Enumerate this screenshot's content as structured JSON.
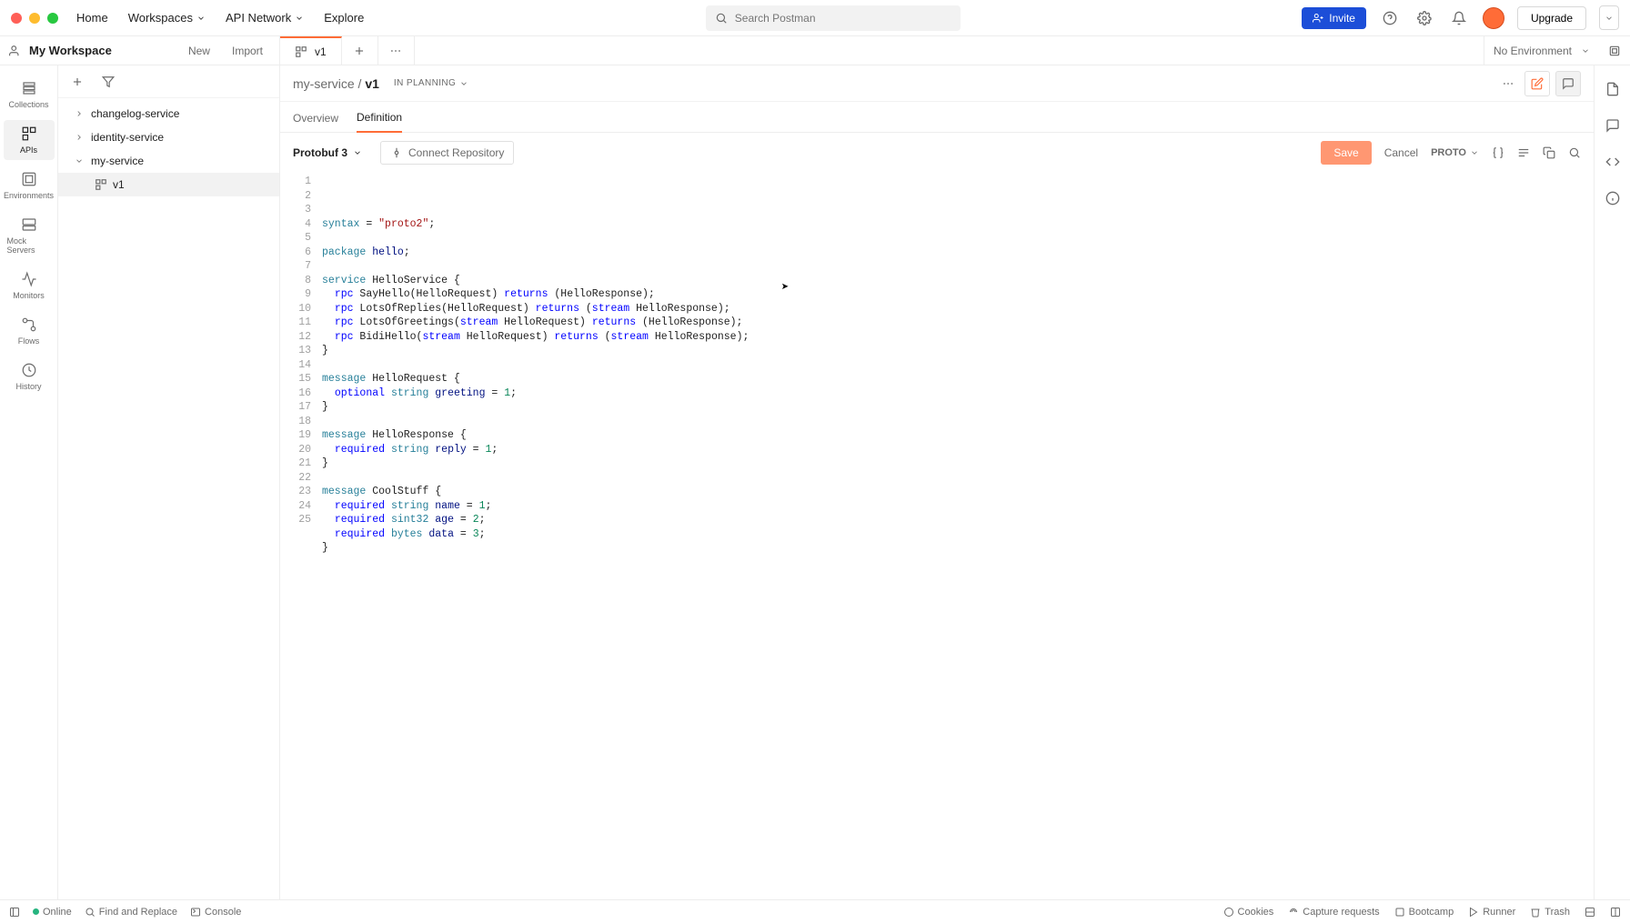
{
  "topnav": {
    "home": "Home",
    "workspaces": "Workspaces",
    "api_network": "API Network",
    "explore": "Explore"
  },
  "search": {
    "placeholder": "Search Postman"
  },
  "topright": {
    "invite": "Invite",
    "upgrade": "Upgrade"
  },
  "workspace": {
    "name": "My Workspace",
    "new": "New",
    "import": "Import"
  },
  "tabs": {
    "active": "v1"
  },
  "env": {
    "label": "No Environment"
  },
  "rail": {
    "collections": "Collections",
    "apis": "APIs",
    "environments": "Environments",
    "mock": "Mock Servers",
    "monitors": "Monitors",
    "flows": "Flows",
    "history": "History"
  },
  "tree": {
    "items": [
      {
        "label": "changelog-service"
      },
      {
        "label": "identity-service"
      },
      {
        "label": "my-service",
        "children": [
          {
            "label": "v1"
          }
        ]
      }
    ]
  },
  "breadcrumb": {
    "parent": "my-service",
    "current": "v1",
    "status": "IN PLANNING"
  },
  "subtabs": {
    "overview": "Overview",
    "definition": "Definition"
  },
  "editor_toolbar": {
    "schema": "Protobuf 3",
    "connect": "Connect Repository",
    "save": "Save",
    "cancel": "Cancel",
    "lang": "PROTO"
  },
  "code": {
    "lines": [
      [
        [
          "kw",
          "syntax"
        ],
        [
          "",
          " = "
        ],
        [
          "str",
          "\"proto2\""
        ],
        [
          "",
          ";"
        ]
      ],
      [],
      [
        [
          "kw",
          "package"
        ],
        [
          "",
          " "
        ],
        [
          "id",
          "hello"
        ],
        [
          "",
          ";"
        ]
      ],
      [],
      [
        [
          "kw",
          "service"
        ],
        [
          "",
          " HelloService {"
        ]
      ],
      [
        [
          "",
          "  "
        ],
        [
          "kw2",
          "rpc"
        ],
        [
          "",
          " SayHello(HelloRequest) "
        ],
        [
          "kw2",
          "returns"
        ],
        [
          "",
          " (HelloResponse);"
        ]
      ],
      [
        [
          "",
          "  "
        ],
        [
          "kw2",
          "rpc"
        ],
        [
          "",
          " LotsOfReplies(HelloRequest) "
        ],
        [
          "kw2",
          "returns"
        ],
        [
          "",
          " ("
        ],
        [
          "kw2",
          "stream"
        ],
        [
          "",
          " HelloResponse);"
        ]
      ],
      [
        [
          "",
          "  "
        ],
        [
          "kw2",
          "rpc"
        ],
        [
          "",
          " LotsOfGreetings("
        ],
        [
          "kw2",
          "stream"
        ],
        [
          "",
          " HelloRequest) "
        ],
        [
          "kw2",
          "returns"
        ],
        [
          "",
          " (HelloResponse);"
        ]
      ],
      [
        [
          "",
          "  "
        ],
        [
          "kw2",
          "rpc"
        ],
        [
          "",
          " BidiHello("
        ],
        [
          "kw2",
          "stream"
        ],
        [
          "",
          " HelloRequest) "
        ],
        [
          "kw2",
          "returns"
        ],
        [
          "",
          " ("
        ],
        [
          "kw2",
          "stream"
        ],
        [
          "",
          " HelloResponse);"
        ]
      ],
      [
        [
          "",
          "}"
        ]
      ],
      [],
      [
        [
          "kw",
          "message"
        ],
        [
          "",
          " HelloRequest {"
        ]
      ],
      [
        [
          "",
          "  "
        ],
        [
          "kw2",
          "optional"
        ],
        [
          "",
          " "
        ],
        [
          "kw",
          "string"
        ],
        [
          "",
          " "
        ],
        [
          "id",
          "greeting"
        ],
        [
          "",
          " = "
        ],
        [
          "num",
          "1"
        ],
        [
          "",
          ";"
        ]
      ],
      [
        [
          "",
          "}"
        ]
      ],
      [],
      [
        [
          "kw",
          "message"
        ],
        [
          "",
          " HelloResponse {"
        ]
      ],
      [
        [
          "",
          "  "
        ],
        [
          "kw2",
          "required"
        ],
        [
          "",
          " "
        ],
        [
          "kw",
          "string"
        ],
        [
          "",
          " "
        ],
        [
          "id",
          "reply"
        ],
        [
          "",
          " = "
        ],
        [
          "num",
          "1"
        ],
        [
          "",
          ";"
        ]
      ],
      [
        [
          "",
          "}"
        ]
      ],
      [],
      [
        [
          "kw",
          "message"
        ],
        [
          "",
          " CoolStuff {"
        ]
      ],
      [
        [
          "",
          "  "
        ],
        [
          "kw2",
          "required"
        ],
        [
          "",
          " "
        ],
        [
          "kw",
          "string"
        ],
        [
          "",
          " "
        ],
        [
          "id",
          "name"
        ],
        [
          "",
          " = "
        ],
        [
          "num",
          "1"
        ],
        [
          "",
          ";"
        ]
      ],
      [
        [
          "",
          "  "
        ],
        [
          "kw2",
          "required"
        ],
        [
          "",
          " "
        ],
        [
          "kw",
          "sint32"
        ],
        [
          "",
          " "
        ],
        [
          "id",
          "age"
        ],
        [
          "",
          " = "
        ],
        [
          "num",
          "2"
        ],
        [
          "",
          ";"
        ]
      ],
      [
        [
          "",
          "  "
        ],
        [
          "kw2",
          "required"
        ],
        [
          "",
          " "
        ],
        [
          "kw",
          "bytes"
        ],
        [
          "",
          " "
        ],
        [
          "id",
          "data"
        ],
        [
          "",
          " = "
        ],
        [
          "num",
          "3"
        ],
        [
          "",
          ";"
        ]
      ],
      [
        [
          "",
          "}"
        ]
      ],
      []
    ]
  },
  "statusbar": {
    "online": "Online",
    "find": "Find and Replace",
    "console": "Console",
    "cookies": "Cookies",
    "capture": "Capture requests",
    "bootcamp": "Bootcamp",
    "runner": "Runner",
    "trash": "Trash"
  }
}
